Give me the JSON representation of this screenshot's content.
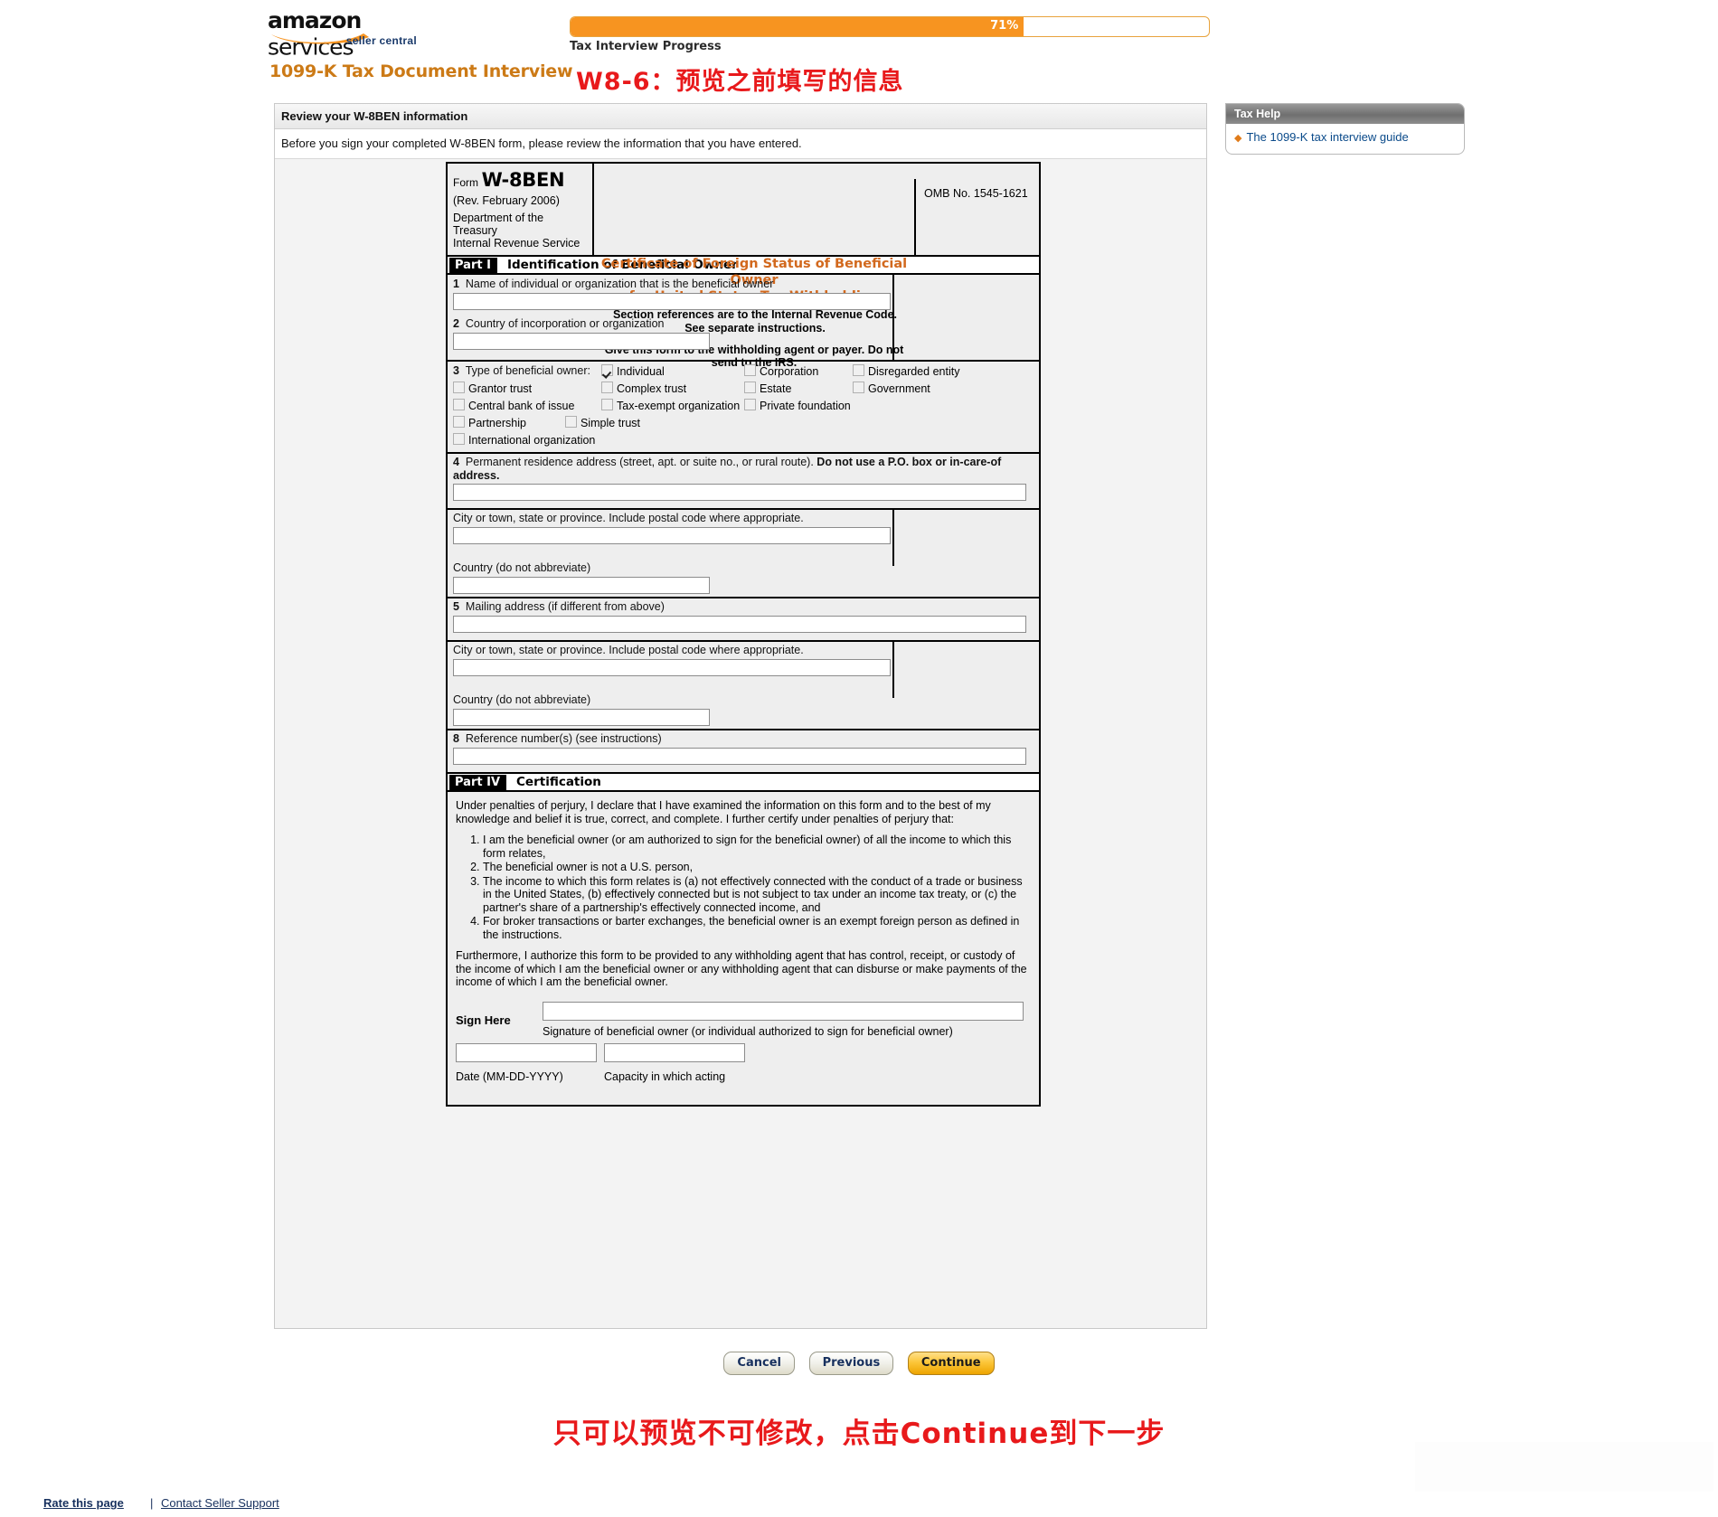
{
  "header": {
    "logo_amazon": "amazon",
    "logo_services": "services",
    "logo_tm": "™",
    "logo_seller_central": "seller central",
    "interview_title": "1099-K Tax Document Interview",
    "cn_annotation": "W8-6：预览之前填写的信息",
    "progress": {
      "percent_label": "71%",
      "percent_value": 71,
      "caption": "Tax Interview Progress",
      "fill_color": "#f79420",
      "border_color": "#e8a33d"
    }
  },
  "panel": {
    "title": "Review your W-8BEN information",
    "intro": "Before you sign your completed W-8BEN form, please review the information that you have entered."
  },
  "form": {
    "form_word": "Form",
    "form_name": "W-8BEN",
    "revision": "(Rev. February 2006)",
    "department": "Department of the Treasury",
    "agency": "Internal Revenue Service",
    "certificate_line1": "Certificate of Foreign Status of Beneficial Owner",
    "certificate_line2": "for United States Tax Withholding",
    "section_references": "Section references are to the Internal Revenue Code. See separate instructions.",
    "give_form": "Give this form to the withholding agent or payer. Do not send to the IRS.",
    "omb": "OMB No. 1545-1621",
    "certificate_color": "#d2691e",
    "part1": {
      "tag": "Part I",
      "name": "Identification of Beneficial Owner",
      "line1_num": "1",
      "line1_label": "Name of individual or organization that is the beneficial owner",
      "line1_value": "",
      "line2_num": "2",
      "line2_label": "Country of incorporation or organization",
      "line2_value": "",
      "line3_num": "3",
      "line3_label": "Type of beneficial owner:",
      "checkboxes": [
        {
          "label": "Individual",
          "checked": true
        },
        {
          "label": "Corporation",
          "checked": false
        },
        {
          "label": "Disregarded entity",
          "checked": false
        },
        {
          "label": "Grantor trust",
          "checked": false
        },
        {
          "label": "Complex trust",
          "checked": false
        },
        {
          "label": "Estate",
          "checked": false
        },
        {
          "label": "Government",
          "checked": false
        },
        {
          "label": "Central bank of issue",
          "checked": false
        },
        {
          "label": "Tax-exempt organization",
          "checked": false
        },
        {
          "label": "Private foundation",
          "checked": false
        },
        {
          "label": "Partnership",
          "checked": false
        },
        {
          "label": "Simple trust",
          "checked": false
        },
        {
          "label": "International organization",
          "checked": false
        }
      ],
      "line4_num": "4",
      "line4_label_plain": "Permanent residence address (street, apt. or suite no., or rural route).",
      "line4_label_bold": "Do not use a P.O. box or in-care-of address.",
      "line4_value": "",
      "line4_city_label": "City or town, state or province. Include postal code where appropriate.",
      "line4_city_value": "",
      "line4_country_label": "Country (do not abbreviate)",
      "line4_country_value": "",
      "line5_num": "5",
      "line5_label": "Mailing address (if different from above)",
      "line5_value": "",
      "line5_city_label": "City or town, state or province. Include postal code where appropriate.",
      "line5_city_value": "",
      "line5_country_label": "Country (do not abbreviate)",
      "line5_country_value": "",
      "line8_num": "8",
      "line8_label": "Reference number(s) (see instructions)",
      "line8_value": ""
    },
    "part4": {
      "tag": "Part IV",
      "name": "Certification",
      "preamble": "Under penalties of perjury, I declare that I have examined the information on this form and to the best of my knowledge and belief it is true, correct, and complete. I further certify under penalties of perjury that:",
      "items": [
        "I am the beneficial owner (or am authorized to sign for the beneficial owner) of all the income to which this form relates,",
        "The beneficial owner is not a U.S. person,",
        "The income to which this form relates is (a) not effectively connected with the conduct of a trade or business in the United States, (b) effectively connected but is not subject to tax under an income tax treaty, or (c) the partner's share of a partnership's effectively connected income, and",
        "For broker transactions or barter exchanges, the beneficial owner is an exempt foreign person as defined in the instructions."
      ],
      "furthermore": "Furthermore, I authorize this form to be provided to any withholding agent that has control, receipt, or custody of the income of which I am the beneficial owner or any withholding agent that can disburse or make payments of the income of which I am the beneficial owner.",
      "sign_here": "Sign Here",
      "signature_value": "",
      "signature_caption": "Signature of beneficial owner (or individual authorized to sign for beneficial owner)",
      "date_value": "",
      "date_label": "Date (MM-DD-YYYY)",
      "capacity_value": "",
      "capacity_label": "Capacity in which acting"
    }
  },
  "tax_help": {
    "title": "Tax Help",
    "links": [
      {
        "label": "The 1099-K tax interview guide"
      }
    ]
  },
  "buttons": {
    "cancel": "Cancel",
    "previous": "Previous",
    "continue": "Continue"
  },
  "cn_annotation_bottom": "只可以预览不可修改，点击Continue到下一步",
  "footer": {
    "rate": "Rate this page",
    "separator": "|",
    "contact": "Contact Seller Support"
  }
}
